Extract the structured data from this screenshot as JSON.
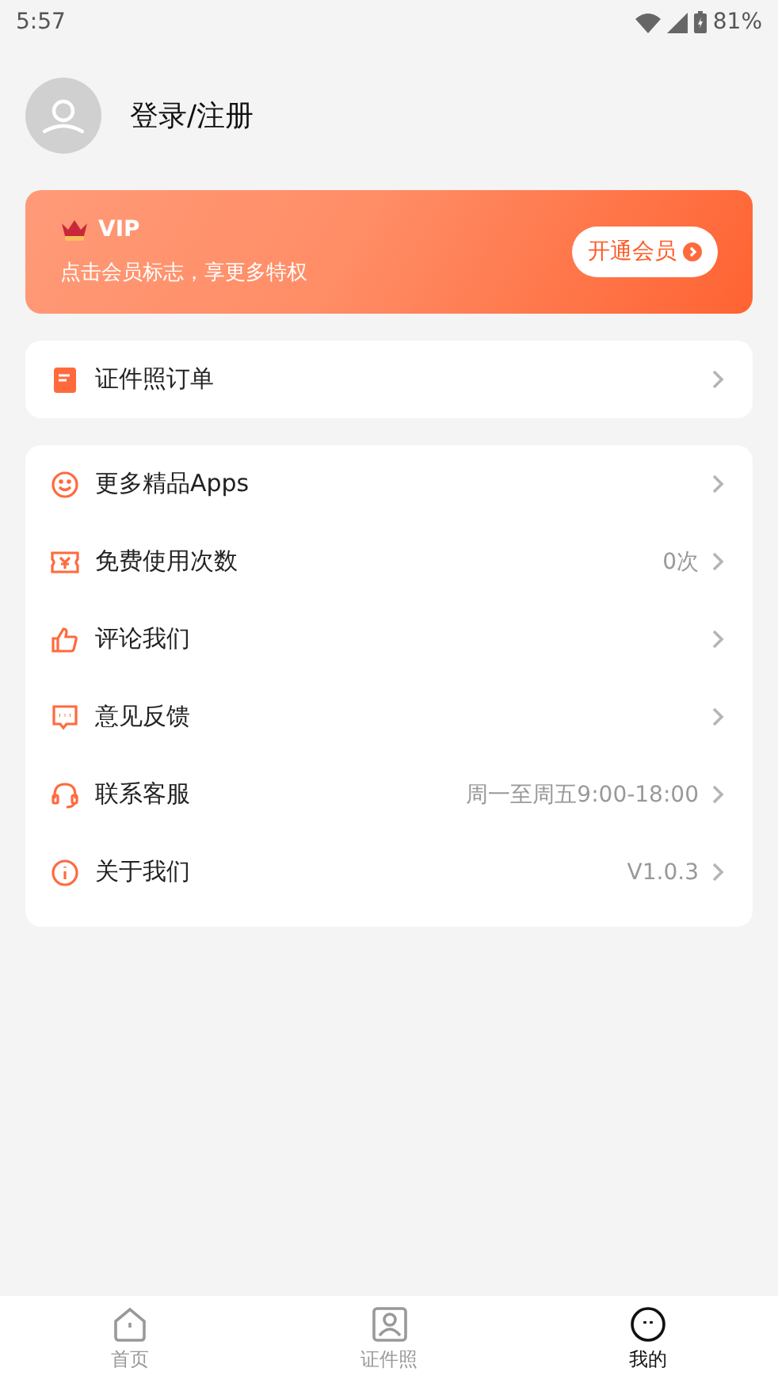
{
  "status_bar": {
    "time": "5:57",
    "battery": "81%"
  },
  "profile": {
    "login": "登录/注册"
  },
  "vip": {
    "title": "VIP",
    "subtitle": "点击会员标志，享更多特权",
    "button": "开通会员"
  },
  "order_menu": [
    {
      "kind": "order",
      "label": "证件照订单"
    }
  ],
  "menu": [
    {
      "kind": "smile",
      "label": "更多精品Apps"
    },
    {
      "kind": "ticket",
      "label": "免费使用次数",
      "value": "0次"
    },
    {
      "kind": "thumb",
      "label": "评论我们"
    },
    {
      "kind": "feedback",
      "label": "意见反馈"
    },
    {
      "kind": "headset",
      "label": "联系客服",
      "value": "周一至周五9:00-18:00"
    },
    {
      "kind": "info",
      "label": "关于我们",
      "value": "V1.0.3"
    }
  ],
  "tabs": [
    {
      "kind": "home",
      "label": "首页",
      "selected": false
    },
    {
      "kind": "photo",
      "label": "证件照",
      "selected": false
    },
    {
      "kind": "me",
      "label": "我的",
      "selected": true
    }
  ]
}
